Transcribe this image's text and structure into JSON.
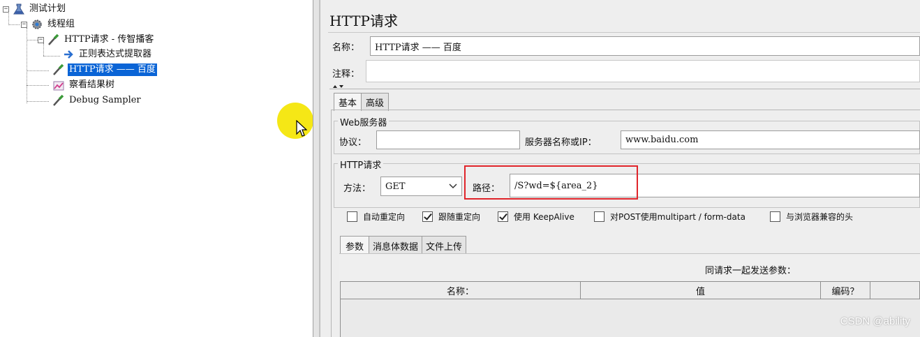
{
  "tree": {
    "items": [
      {
        "label": "测试计划",
        "icon": "test-plan-icon"
      },
      {
        "label": "线程组",
        "icon": "thread-group-gear-icon"
      },
      {
        "label": "HTTP请求 - 传智播客",
        "icon": "http-sampler-pipette-icon"
      },
      {
        "label": "正则表达式提取器",
        "icon": "regex-extractor-arrow-icon"
      },
      {
        "label": "HTTP请求 —— 百度",
        "icon": "http-sampler-pipette-icon",
        "selected": true
      },
      {
        "label": "察看结果树",
        "icon": "results-tree-chart-icon"
      },
      {
        "label": "Debug Sampler",
        "icon": "debug-sampler-pipette-icon"
      }
    ]
  },
  "panel": {
    "title": "HTTP请求",
    "name_label": "名称：",
    "name_value": "HTTP请求 —— 百度",
    "comment_label": "注释：",
    "comment_value": "",
    "tabs": [
      "基本",
      "高级"
    ],
    "web_server": {
      "group_title": "Web服务器",
      "protocol_label": "协议：",
      "protocol_value": "",
      "server_label": "服务器名称或IP：",
      "server_value": "www.baidu.com"
    },
    "http_request": {
      "group_title": "HTTP请求",
      "method_label": "方法：",
      "method_value": "GET",
      "path_label": "路径：",
      "path_value": "/S?wd=${area_2}"
    },
    "options": [
      {
        "label": "自动重定向",
        "checked": false
      },
      {
        "label": "跟随重定向",
        "checked": true
      },
      {
        "label": "使用 KeepAlive",
        "checked": true
      },
      {
        "label": "对POST使用multipart / form-data",
        "checked": false
      },
      {
        "label": "与浏览器兼容的头",
        "checked": false
      }
    ],
    "body_tabs": [
      "参数",
      "消息体数据",
      "文件上传"
    ],
    "params_caption": "同请求一起发送参数：",
    "columns": [
      "名称：",
      "值",
      "编码？"
    ]
  },
  "watermark": "CSDN @ability",
  "colors": {
    "selection": "#0a64d6",
    "highlight_box": "#e0242a",
    "cursor_halo": "#f4e60a"
  }
}
